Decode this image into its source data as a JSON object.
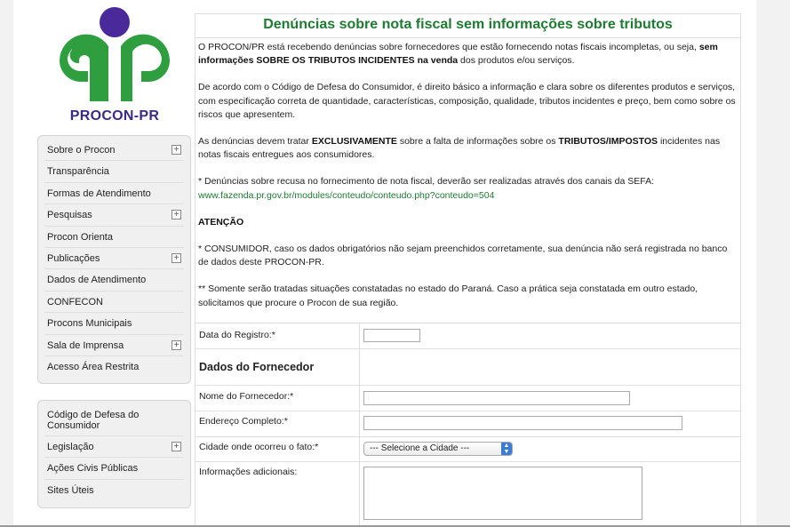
{
  "logo": {
    "text": "PROCON-PR",
    "colors": {
      "green": "#2e9e3e",
      "purple": "#3b2a8a"
    }
  },
  "sidebar": {
    "menu1": [
      {
        "label": "Sobre o Procon",
        "expandable": true
      },
      {
        "label": "Transparência",
        "expandable": false
      },
      {
        "label": "Formas de Atendimento",
        "expandable": false
      },
      {
        "label": "Pesquisas",
        "expandable": true
      },
      {
        "label": "Procon Orienta",
        "expandable": false
      },
      {
        "label": "Publicações",
        "expandable": true
      },
      {
        "label": "Dados de Atendimento",
        "expandable": false
      },
      {
        "label": "CONFECON",
        "expandable": false
      },
      {
        "label": "Procons Municipais",
        "expandable": false
      },
      {
        "label": "Sala de Imprensa",
        "expandable": true
      },
      {
        "label": "Acesso Área Restrita",
        "expandable": false
      }
    ],
    "menu2": [
      {
        "label": "Código de Defesa do Consumidor",
        "expandable": false
      },
      {
        "label": "Legislação",
        "expandable": true
      },
      {
        "label": "Ações Civis Públicas",
        "expandable": false
      },
      {
        "label": "Sites Úteis",
        "expandable": false
      }
    ],
    "expand_symbol": "+"
  },
  "main": {
    "title": "Denúncias sobre nota fiscal sem informações sobre tributos",
    "p1_a": "O PROCON/PR está recebendo denúncias sobre fornecedores que estão fornecendo notas fiscais incompletas, ou seja, ",
    "p1_b": "sem informações SOBRE OS TRIBUTOS INCIDENTES na venda",
    "p1_c": " dos produtos e/ou serviços.",
    "p2": "De acordo com o Código de Defesa do Consumidor, é direito básico a informação e clara sobre os diferentes produtos e serviços, com especificação correta de quantidade, características, composição, qualidade, tributos incidentes e preço, bem como sobre os riscos que apresentem.",
    "p3_a": "As denúncias devem tratar ",
    "p3_b": "EXCLUSIVAMENTE",
    "p3_c": " sobre a falta de informações sobre os ",
    "p3_d": "TRIBUTOS/IMPOSTOS",
    "p3_e": " incidentes nas notas fiscais entregues aos consumidores.",
    "p4_a": "* Denúncias sobre recusa no fornecimento de nota fiscal, deverão ser realizadas através dos canais da SEFA:",
    "p4_link": "www.fazenda.pr.gov.br/modules/conteudo/conteudo.php?conteudo=504",
    "attention": "ATENÇÃO",
    "p5": "* CONSUMIDOR, caso os dados obrigatórios não sejam preenchidos corretamente, sua denúncia não será registrada no banco de dados deste PROCON-PR.",
    "p6": "** Somente serão tratadas situações constatadas no estado do Paraná. Caso a prática seja constatada em outro estado, solicitamos que procure o Procon de sua região."
  },
  "form": {
    "date_label": "Data do Registro:*",
    "date_value": "",
    "section_title": "Dados do Fornecedor",
    "supplier_name_label": "Nome do Fornecedor:*",
    "supplier_name_value": "",
    "address_label": "Endereço Completo:*",
    "address_value": "",
    "city_label": "Cidade onde ocorreu o fato:*",
    "city_selected": "--- Selecione a Cidade ---",
    "info_label": "Informações adicionais:",
    "info_value": ""
  }
}
